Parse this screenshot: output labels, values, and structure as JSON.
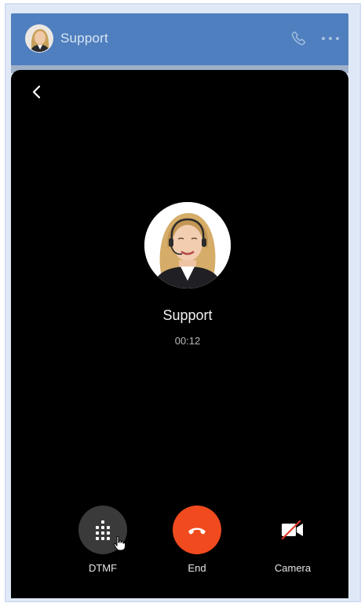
{
  "header": {
    "title": "Support",
    "color": "#4f7fbe",
    "phone_icon": "phone-icon",
    "more_icon": "more-horizontal-icon"
  },
  "call": {
    "back_icon": "chevron-left-icon",
    "caller_name": "Support",
    "duration": "00:12"
  },
  "controls": [
    {
      "label": "DTMF",
      "icon": "dialpad-icon"
    },
    {
      "label": "End",
      "icon": "hang-up-icon",
      "color": "#f04a1e"
    },
    {
      "label": "Camera",
      "icon": "camera-off-icon"
    }
  ]
}
